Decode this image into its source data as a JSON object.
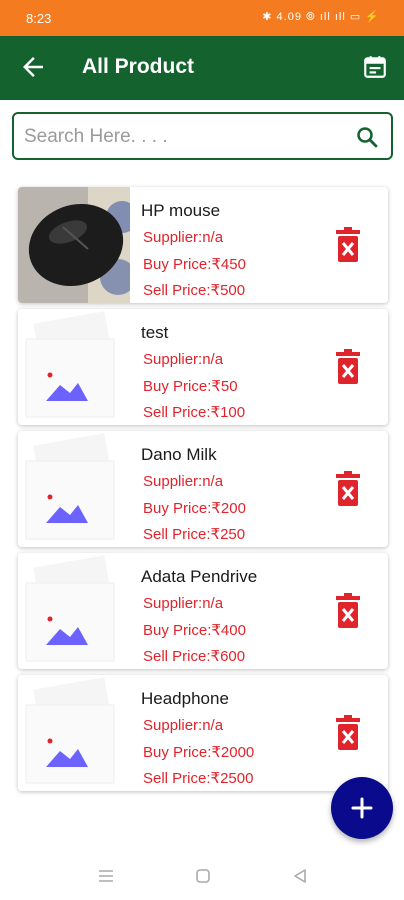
{
  "status": {
    "time": "8:23",
    "icons_text": "✱ 4.09 ⦾ ıll ıll ▭ ⚡"
  },
  "header": {
    "title": "All Product"
  },
  "search": {
    "placeholder": "Search Here. . . ."
  },
  "products": [
    {
      "name": "HP mouse",
      "supplier": "Supplier:n/a",
      "buy": "Buy Price:₹450",
      "sell": "Sell Price:₹500",
      "image": "mouse-photo"
    },
    {
      "name": "test",
      "supplier": "Supplier:n/a",
      "buy": "Buy Price:₹50",
      "sell": "Sell Price:₹100",
      "image": "placeholder"
    },
    {
      "name": "Dano Milk",
      "supplier": "Supplier:n/a",
      "buy": "Buy Price:₹200",
      "sell": "Sell Price:₹250",
      "image": "placeholder"
    },
    {
      "name": "Adata Pendrive",
      "supplier": "Supplier:n/a",
      "buy": "Buy Price:₹400",
      "sell": "Sell Price:₹600",
      "image": "placeholder"
    },
    {
      "name": "Headphone",
      "supplier": "Supplier:n/a",
      "buy": "Buy Price:₹2000",
      "sell": "Sell Price:₹2500",
      "image": "placeholder"
    }
  ],
  "colors": {
    "status_bar": "#f47b20",
    "app_bar": "#14632f",
    "price_text": "#e0242c",
    "delete_icon": "#e0242c",
    "fab": "#0a0a8c"
  },
  "icons": [
    "back-arrow-icon",
    "calendar-icon",
    "search-icon",
    "delete-icon",
    "add-icon",
    "recents-icon",
    "home-icon",
    "back-nav-icon"
  ]
}
